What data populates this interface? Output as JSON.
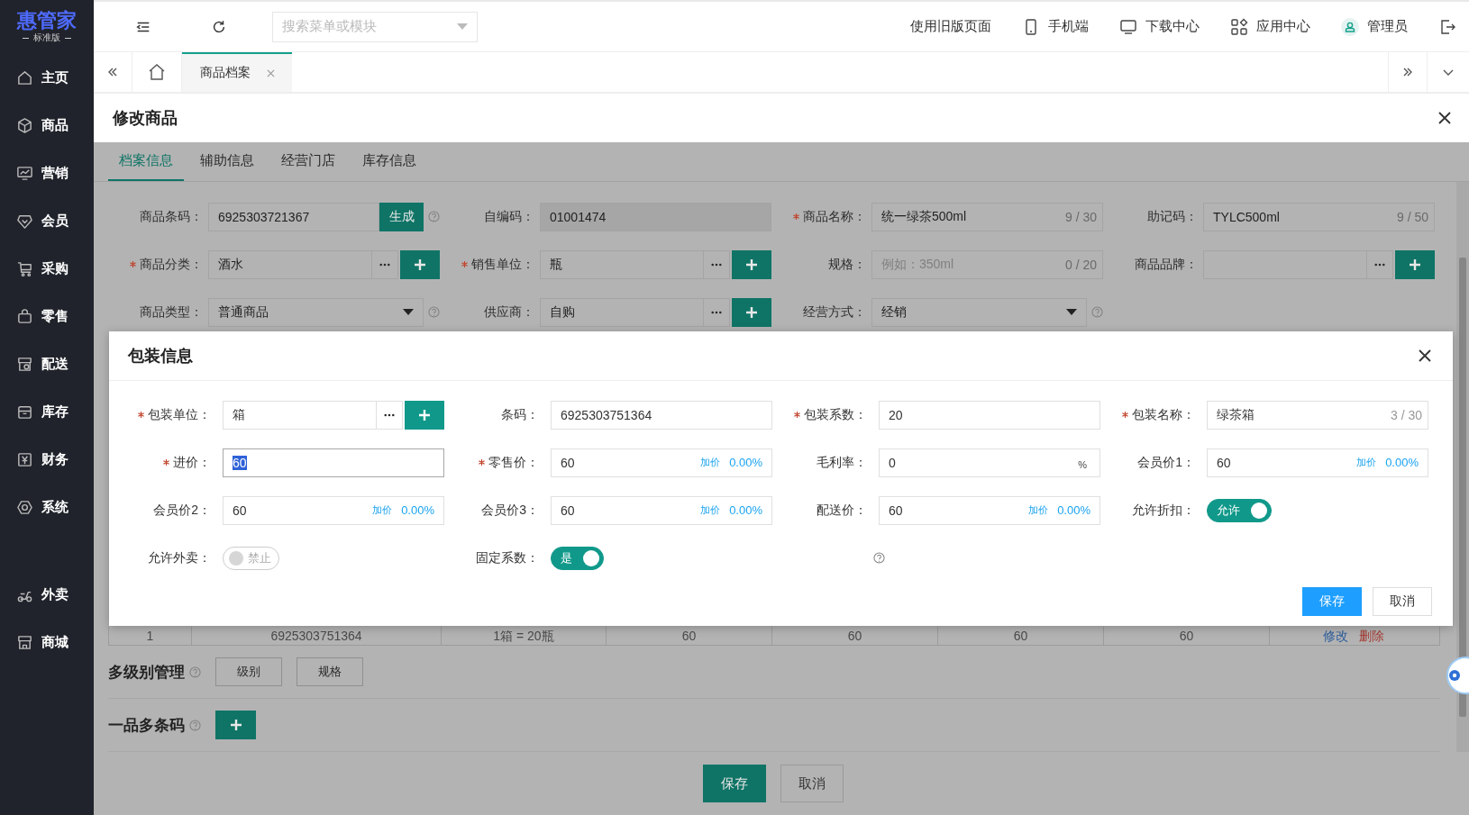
{
  "logo": {
    "title": "惠管家",
    "subtitle": "标准版"
  },
  "sidebar": {
    "items": [
      {
        "label": "主页"
      },
      {
        "label": "商品"
      },
      {
        "label": "营销"
      },
      {
        "label": "会员"
      },
      {
        "label": "采购"
      },
      {
        "label": "零售"
      },
      {
        "label": "配送"
      },
      {
        "label": "库存"
      },
      {
        "label": "财务"
      },
      {
        "label": "系统"
      }
    ],
    "extra_items": [
      {
        "label": "外卖"
      },
      {
        "label": "商城"
      }
    ]
  },
  "header": {
    "search": {
      "placeholder": "搜索菜单或模块"
    },
    "links": [
      {
        "label": "使用旧版页面"
      },
      {
        "label": "手机端"
      },
      {
        "label": "下载中心"
      },
      {
        "label": "应用中心"
      },
      {
        "label": "管理员"
      }
    ]
  },
  "page_tabs": [
    {
      "label": "商品档案",
      "selected": true
    }
  ],
  "panel": {
    "title": "修改商品",
    "tabs": [
      {
        "label": "档案信息",
        "selected": true
      },
      {
        "label": "辅助信息",
        "selected": false
      },
      {
        "label": "经营门店",
        "selected": false
      },
      {
        "label": "库存信息",
        "selected": false
      }
    ],
    "fields": [
      {
        "kind": "text",
        "label": "商品条码：",
        "required": false,
        "disabled": false,
        "help": true,
        "value": "6925303721367",
        "action": "生成"
      },
      {
        "kind": "text",
        "label": "自编码：",
        "required": false,
        "disabled": true,
        "help": false,
        "value": "01001474"
      },
      {
        "kind": "text",
        "label": "商品名称：",
        "required": true,
        "disabled": false,
        "help": false,
        "value": "统一绿茶500ml",
        "counter": "9 / 30"
      },
      {
        "kind": "text",
        "label": "助记码：",
        "required": false,
        "disabled": false,
        "help": false,
        "value": "TYLC500ml",
        "counter": "9 / 50"
      },
      {
        "kind": "picker",
        "label": "商品分类：",
        "required": true,
        "disabled": false,
        "help": false,
        "value": "酒水"
      },
      {
        "kind": "picker",
        "label": "销售单位：",
        "required": true,
        "disabled": false,
        "help": false,
        "value": "瓶"
      },
      {
        "kind": "text",
        "label": "规格：",
        "required": false,
        "disabled": false,
        "help": false,
        "placeholder": "例如：350ml",
        "counter": "0 / 20"
      },
      {
        "kind": "picker",
        "label": "商品品牌：",
        "required": false,
        "disabled": false,
        "help": false
      },
      {
        "kind": "dropdown",
        "label": "商品类型：",
        "required": false,
        "disabled": false,
        "help": true,
        "value": "普通商品"
      },
      {
        "kind": "picker",
        "label": "供应商：",
        "required": false,
        "disabled": false,
        "help": false,
        "value": "自购"
      },
      {
        "kind": "dropdown",
        "label": "经营方式：",
        "required": false,
        "disabled": false,
        "help": true,
        "value": "经销"
      }
    ],
    "table_row": {
      "cells": [
        "1",
        "6925303751364",
        "1箱 = 20瓶",
        "60",
        "60",
        "60",
        "60"
      ],
      "actions": [
        {
          "label": "修改",
          "kind": "edit"
        },
        {
          "label": "删除",
          "kind": "delete"
        }
      ]
    },
    "sections": [
      {
        "title": "多级别管理",
        "help": true,
        "buttons": [
          {
            "kind": "text",
            "label": "级别"
          },
          {
            "kind": "text",
            "label": "规格"
          }
        ]
      },
      {
        "title": "一品多条码",
        "help": true,
        "buttons": [
          {
            "kind": "add"
          }
        ]
      }
    ],
    "buttons": [
      {
        "label": "保存",
        "kind": "primary"
      },
      {
        "label": "取消",
        "kind": "default"
      }
    ]
  },
  "dialog": {
    "title": "包装信息",
    "fields": [
      {
        "kind": "picker",
        "label": "包装单位：",
        "required": true,
        "focused": false,
        "value": "箱"
      },
      {
        "kind": "text",
        "label": "条码：",
        "required": false,
        "focused": false,
        "value": "6925303751364"
      },
      {
        "kind": "text",
        "label": "包装系数：",
        "required": true,
        "focused": false,
        "value": "20"
      },
      {
        "kind": "text",
        "label": "包装名称：",
        "required": true,
        "focused": false,
        "value": "绿茶箱",
        "counter": "3 / 30"
      },
      {
        "kind": "text",
        "label": "进价：",
        "required": true,
        "focused": true,
        "value": "60"
      },
      {
        "kind": "price",
        "label": "零售价：",
        "required": true,
        "focused": false,
        "value": "60",
        "markup_label": "加价",
        "markup": "0.00%"
      },
      {
        "kind": "text",
        "label": "毛利率：",
        "required": false,
        "focused": false,
        "value": "0",
        "suffix": "%"
      },
      {
        "kind": "price",
        "label": "会员价1：",
        "required": false,
        "focused": false,
        "value": "60",
        "markup_label": "加价",
        "markup": "0.00%"
      },
      {
        "kind": "price",
        "label": "会员价2：",
        "required": false,
        "focused": false,
        "value": "60",
        "markup_label": "加价",
        "markup": "0.00%"
      },
      {
        "kind": "price",
        "label": "会员价3：",
        "required": false,
        "focused": false,
        "value": "60",
        "markup_label": "加价",
        "markup": "0.00%"
      },
      {
        "kind": "price",
        "label": "配送价：",
        "required": false,
        "focused": false,
        "value": "60",
        "markup_label": "加价",
        "markup": "0.00%"
      },
      {
        "kind": "switch",
        "label": "允许折扣：",
        "required": false,
        "on": true,
        "text": "允许"
      },
      {
        "kind": "switch",
        "label": "允许外卖：",
        "required": false,
        "on": false,
        "text": "禁止"
      },
      {
        "kind": "switch",
        "label": "固定系数：",
        "required": false,
        "on": true,
        "text": "是"
      },
      {
        "kind": "help"
      }
    ],
    "buttons": [
      {
        "label": "保存",
        "kind": "primary"
      },
      {
        "label": "取消",
        "kind": "default"
      }
    ]
  }
}
